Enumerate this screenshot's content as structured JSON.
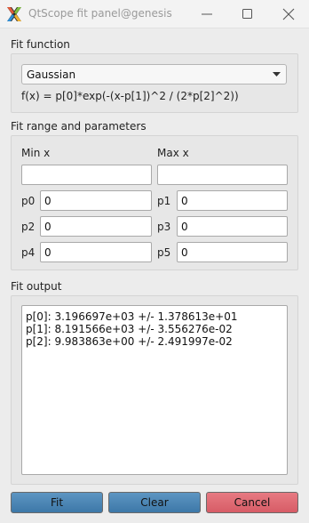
{
  "window": {
    "title": "QtScope fit panel@genesis",
    "app_icon": "x-logo-icon"
  },
  "fit_function": {
    "group_title": "Fit function",
    "selected_function": "Gaussian",
    "formula": "f(x) = p[0]*exp(-(x-p[1])^2 / (2*p[2]^2))"
  },
  "fit_range": {
    "group_title": "Fit range and parameters",
    "min_x_label": "Min x",
    "max_x_label": "Max x",
    "min_x_value": "",
    "max_x_value": "",
    "params": [
      {
        "label": "p0",
        "value": "0"
      },
      {
        "label": "p1",
        "value": "0"
      },
      {
        "label": "p2",
        "value": "0"
      },
      {
        "label": "p3",
        "value": "0"
      },
      {
        "label": "p4",
        "value": "0"
      },
      {
        "label": "p5",
        "value": "0"
      }
    ]
  },
  "fit_output": {
    "group_title": "Fit output",
    "lines": [
      "p[0]: 3.196697e+03 +/- 1.378613e+01",
      "p[1]: 8.191566e+03 +/- 3.556276e-02",
      "p[2]: 9.983863e+00 +/- 2.491997e-02"
    ]
  },
  "buttons": {
    "fit": "Fit",
    "clear": "Clear",
    "cancel": "Cancel"
  },
  "colors": {
    "fit_button": "#4a86b6",
    "clear_button": "#4a86b6",
    "cancel_button": "#df6870"
  }
}
